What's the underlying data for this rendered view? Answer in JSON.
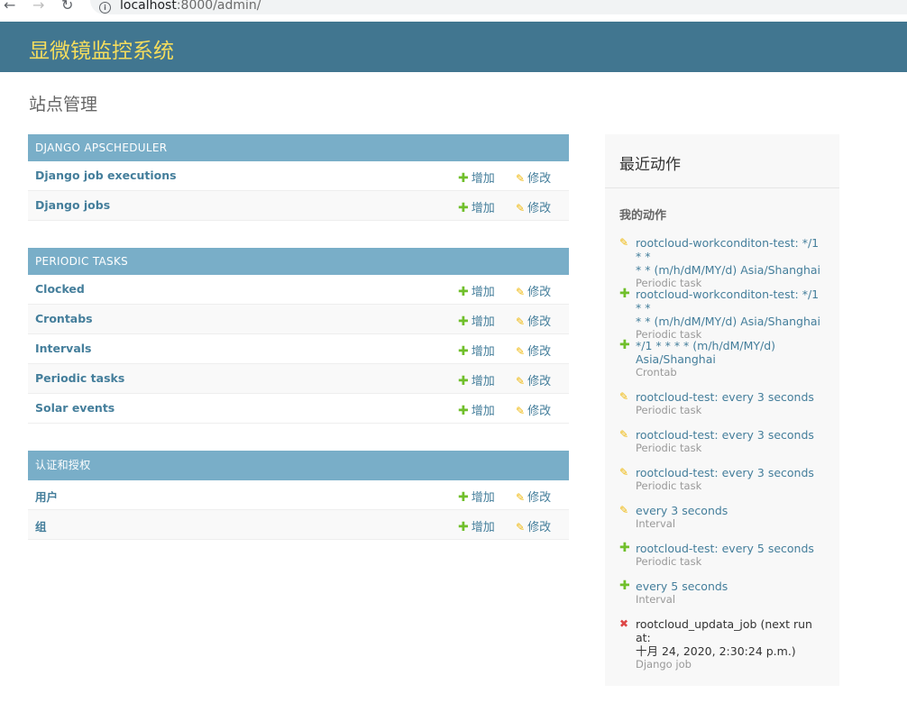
{
  "browser": {
    "url_host": "localhost",
    "url_rest": ":8000/admin/",
    "back_glyph": "←",
    "forward_glyph": "→",
    "reload_glyph": "↻",
    "info_glyph": "i"
  },
  "header": {
    "branding": "显微镜监控系统"
  },
  "page_title": "站点管理",
  "icons": {
    "add": "✚",
    "change": "✎",
    "delete": "✖"
  },
  "links": {
    "add_label": "增加",
    "change_label": "修改"
  },
  "modules": [
    {
      "caption": "DJANGO APSCHEDULER",
      "rows": [
        "Django job executions",
        "Django jobs"
      ]
    },
    {
      "caption": "PERIODIC TASKS",
      "rows": [
        "Clocked",
        "Crontabs",
        "Intervals",
        "Periodic tasks",
        "Solar events"
      ]
    },
    {
      "caption": "认证和授权",
      "rows": [
        "用户",
        "组"
      ]
    }
  ],
  "recent_actions": {
    "title": "最近动作",
    "subtitle": "我的动作",
    "items": [
      {
        "type": "change",
        "lines": [
          "rootcloud-workconditon-test: */1 * *",
          "* * (m/h/dM/MY/d) Asia/Shanghai"
        ],
        "model": "Periodic task"
      },
      {
        "type": "add",
        "lines": [
          "rootcloud-workconditon-test: */1 * *",
          "* * (m/h/dM/MY/d) Asia/Shanghai"
        ],
        "model": "Periodic task"
      },
      {
        "type": "add",
        "lines": [
          "*/1 * * * * (m/h/dM/MY/d)",
          "Asia/Shanghai"
        ],
        "model": "Crontab"
      },
      {
        "type": "change",
        "lines": [
          "rootcloud-test: every 3 seconds"
        ],
        "model": "Periodic task"
      },
      {
        "type": "change",
        "lines": [
          "rootcloud-test: every 3 seconds"
        ],
        "model": "Periodic task"
      },
      {
        "type": "change",
        "lines": [
          "rootcloud-test: every 3 seconds"
        ],
        "model": "Periodic task"
      },
      {
        "type": "change",
        "lines": [
          "every 3 seconds"
        ],
        "model": "Interval"
      },
      {
        "type": "add",
        "lines": [
          "rootcloud-test: every 5 seconds"
        ],
        "model": "Periodic task"
      },
      {
        "type": "add",
        "lines": [
          "every 5 seconds"
        ],
        "model": "Interval"
      },
      {
        "type": "delete",
        "lines": [
          "rootcloud_updata_job (next run at:",
          "十月 24, 2020, 2:30:24 p.m.)"
        ],
        "model": "Django job"
      }
    ]
  },
  "colors": {
    "header_bg": "#417690",
    "branding": "#f5dd5d",
    "module_caption_bg": "#79aec8",
    "link": "#447e9b",
    "add_icon": "#70bf2b",
    "change_icon": "#efb80b",
    "delete_icon": "#dd4646"
  }
}
